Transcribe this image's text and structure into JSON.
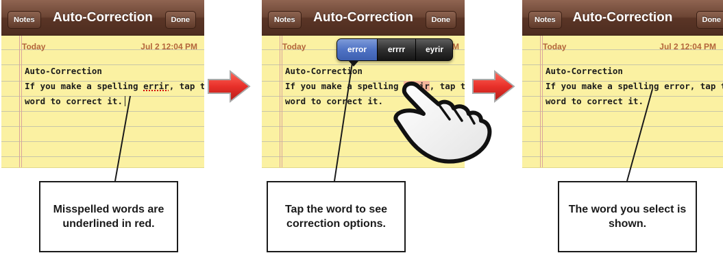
{
  "steps": [
    {
      "nav": {
        "back": "Notes",
        "title": "Auto-Correction",
        "done": "Done"
      },
      "date": {
        "today": "Today",
        "stamp": "Jul 2  12:04 PM"
      },
      "note": {
        "heading": "Auto-Correction",
        "line1_pre": "If you make a spelling ",
        "line1_word": "errir",
        "line1_post": ", tap the",
        "line2": "word to correct it."
      },
      "callout": "Misspelled words are underlined in red."
    },
    {
      "nav": {
        "back": "Notes",
        "title": "Auto-Correction",
        "done": "Done"
      },
      "date": {
        "today": "Today",
        "stamp": "M"
      },
      "note": {
        "heading": "Auto-Correction",
        "line1_pre": "If you make a spelling ",
        "line1_word": "errir",
        "line1_post": ", tap the",
        "line2": "word to correct it."
      },
      "suggestions": [
        "error",
        "errrr",
        "eyrir"
      ],
      "callout": "Tap the word to see correction options."
    },
    {
      "nav": {
        "back": "Notes",
        "title": "Auto-Correction",
        "done": "Done"
      },
      "date": {
        "today": "Today",
        "stamp": "Jul 2  12:04 PM"
      },
      "note": {
        "heading": "Auto-Correction",
        "line1": "If you make a spelling error, tap the",
        "line2": "word to correct it."
      },
      "callout": "The word you select is shown."
    }
  ],
  "colors": {
    "paper": "#fbf1a2",
    "navbar": "#6c4534",
    "date_text": "#b3653b",
    "arrow": "#e8302a",
    "selected_suggestion": "#4f72c4",
    "misspelling_underline": "#d20000"
  },
  "icons": [
    "right-arrow-icon",
    "pointing-hand-icon"
  ]
}
